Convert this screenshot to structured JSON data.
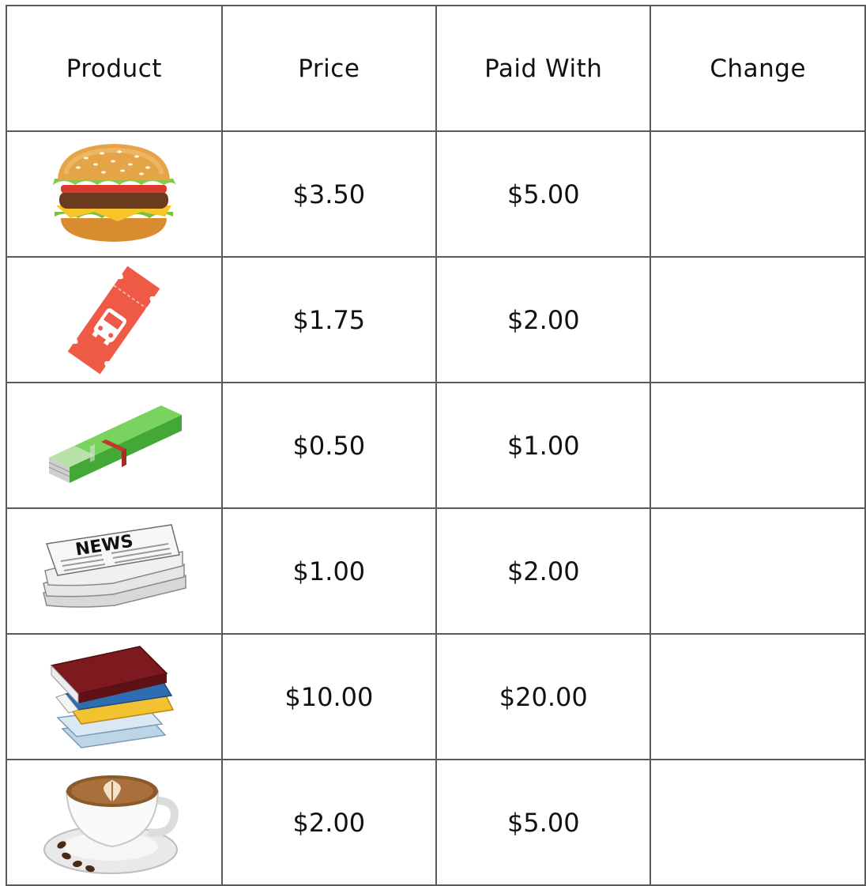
{
  "table": {
    "headers": {
      "product": "Product",
      "price": "Price",
      "paid_with": "Paid With",
      "change": "Change"
    },
    "rows": [
      {
        "icon": "hamburger-icon",
        "price": "$3.50",
        "paid_with": "$5.00",
        "change": ""
      },
      {
        "icon": "bus-ticket-icon",
        "price": "$1.75",
        "paid_with": "$2.00",
        "change": ""
      },
      {
        "icon": "chewing-gum-icon",
        "price": "$0.50",
        "paid_with": "$1.00",
        "change": ""
      },
      {
        "icon": "newspaper-icon",
        "price": "$1.00",
        "paid_with": "$2.00",
        "change": ""
      },
      {
        "icon": "books-icon",
        "price": "$10.00",
        "paid_with": "$20.00",
        "change": ""
      },
      {
        "icon": "coffee-cup-icon",
        "price": "$2.00",
        "paid_with": "$5.00",
        "change": ""
      }
    ],
    "newspaper_masthead": "NEWS"
  },
  "colors": {
    "border": "#5a5a5a",
    "ticket": "#ee5a45",
    "gum": "#4fbf3f"
  }
}
